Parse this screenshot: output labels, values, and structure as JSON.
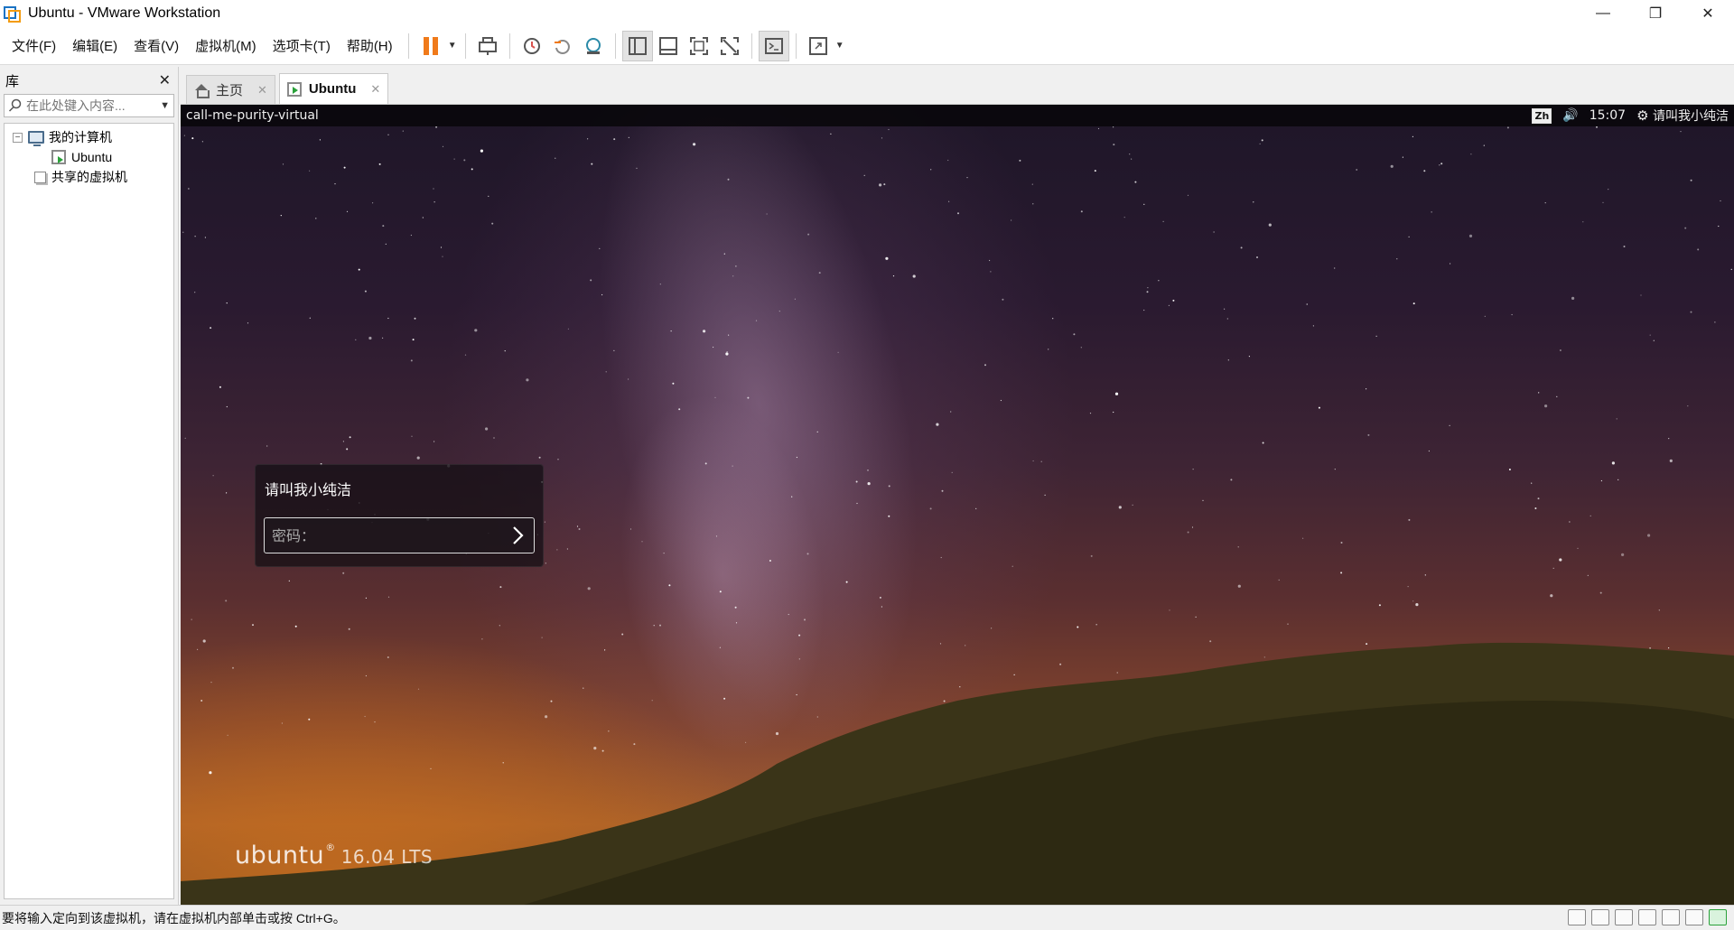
{
  "window": {
    "title": "Ubuntu - VMware Workstation",
    "controls": {
      "minimize": "—",
      "restore": "❐",
      "close": "✕"
    }
  },
  "menu": {
    "items": [
      "文件(F)",
      "编辑(E)",
      "查看(V)",
      "虚拟机(M)",
      "选项卡(T)",
      "帮助(H)"
    ]
  },
  "library": {
    "title": "库",
    "close": "✕",
    "search_placeholder": "在此处键入内容...",
    "tree": {
      "root_toggle": "−",
      "my_computer": "我的计算机",
      "vm_ubuntu": "Ubuntu",
      "shared_vms": "共享的虚拟机"
    }
  },
  "tabs": [
    {
      "label": "主页",
      "close": "✕"
    },
    {
      "label": "Ubuntu",
      "close": "✕"
    }
  ],
  "ubuntu": {
    "hostname": "call-me-purity-virtual",
    "input_method": "Zh",
    "volume_icon": "🔊",
    "time": "15:07",
    "power_icon": "⚙",
    "user_menu": "请叫我小纯洁",
    "login": {
      "username": "请叫我小纯洁",
      "password_placeholder": "密码："
    },
    "logo_text": "ubuntu",
    "logo_reg": "®",
    "version": "16.04 LTS"
  },
  "statusbar": {
    "message": "要将输入定向到该虚拟机，请在虚拟机内部单击或按 Ctrl+G。"
  },
  "colors": {
    "pause_orange": "#f07a1a",
    "vm_green": "#2aa13a",
    "vmware_blue": "#1a73c4"
  }
}
